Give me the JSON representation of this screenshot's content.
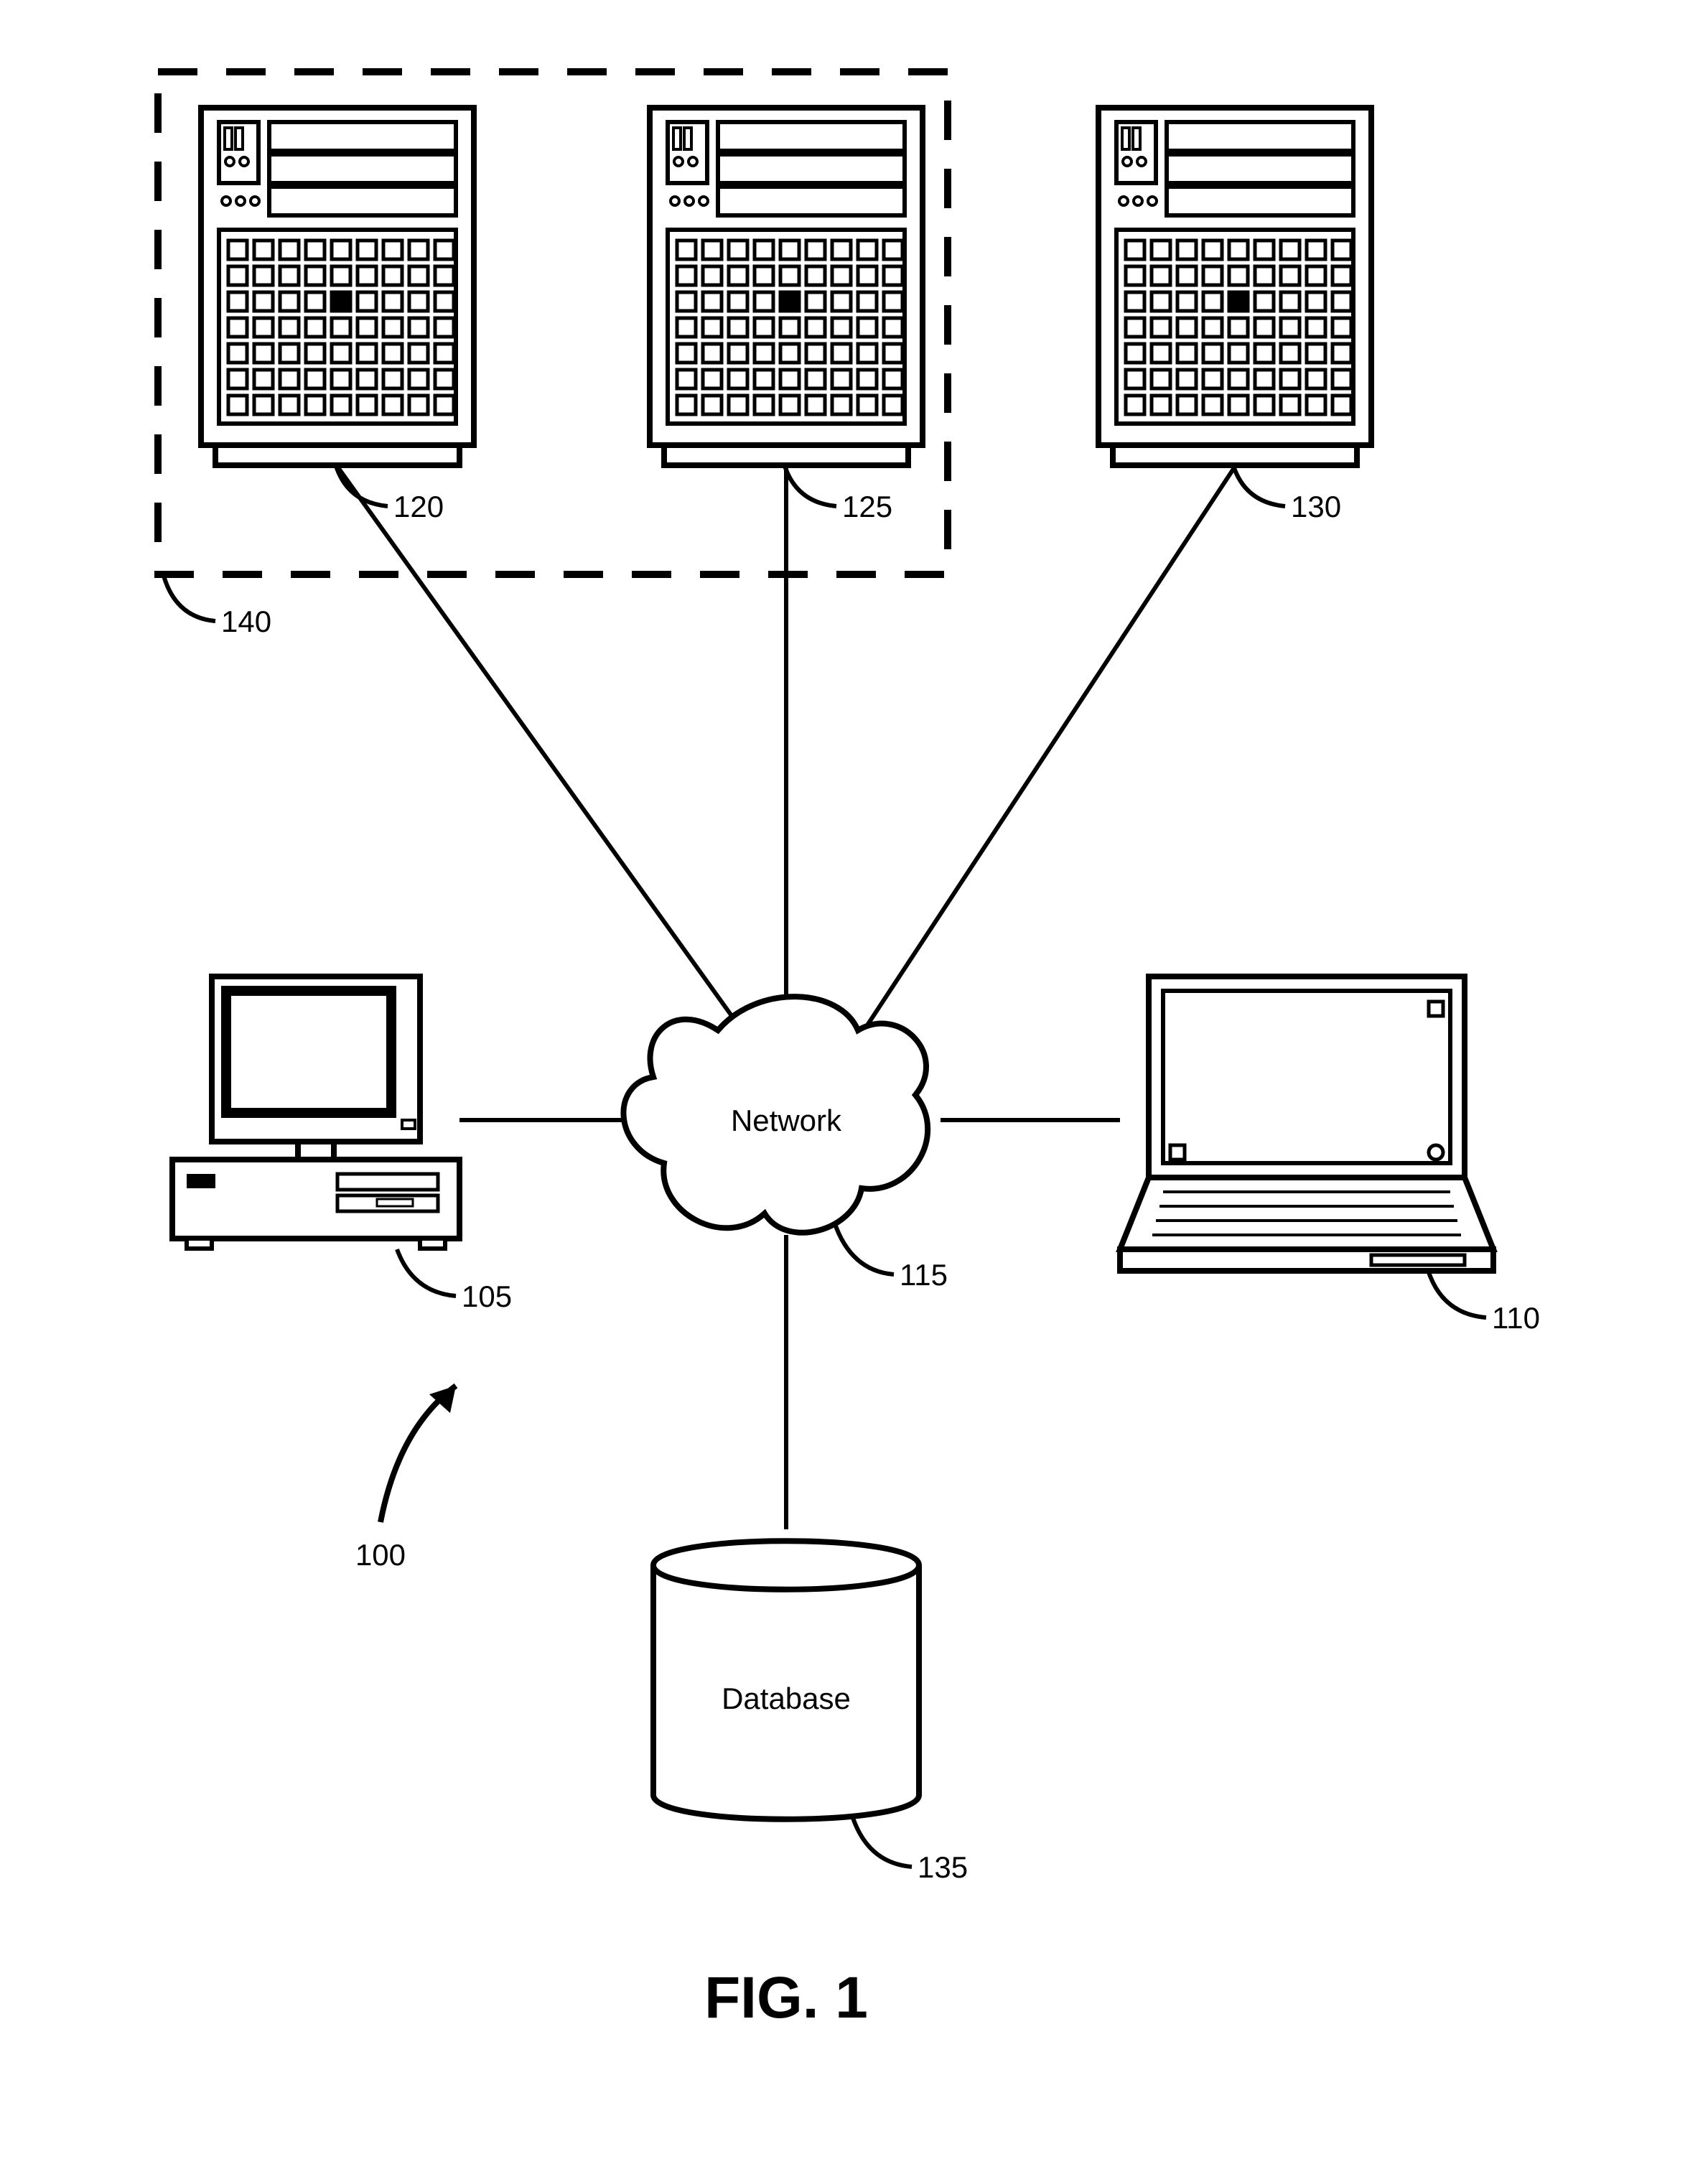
{
  "figure": {
    "title": "FIG. 1",
    "network_label": "Network",
    "database_label": "Database",
    "system_ref": "100",
    "refs": {
      "desktop": "105",
      "laptop": "110",
      "network": "115",
      "server_a": "120",
      "server_b": "125",
      "server_c": "130",
      "database": "135",
      "cluster": "140"
    }
  }
}
